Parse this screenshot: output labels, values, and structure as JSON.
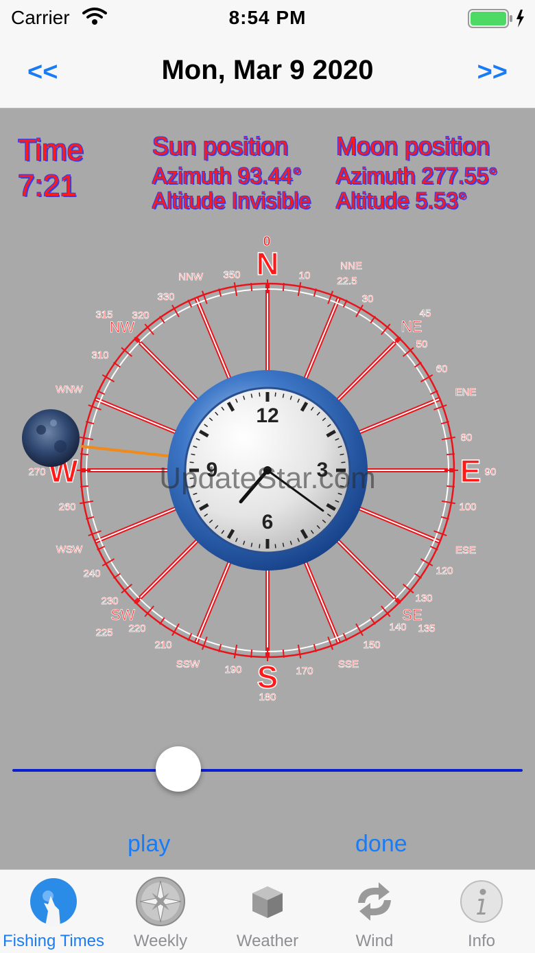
{
  "status_bar": {
    "carrier": "Carrier",
    "time": "8:54 PM"
  },
  "nav": {
    "prev_label": "<<",
    "title": "Mon, Mar 9 2020",
    "next_label": ">>"
  },
  "time_panel": {
    "label": "Time",
    "value": "7:21"
  },
  "sun": {
    "title": "Sun position",
    "azimuth": "Azimuth 93.44°",
    "altitude": "Altitude  Invisible"
  },
  "moon": {
    "title": "Moon position",
    "azimuth": "Azimuth 277.55°",
    "altitude": "Altitude  5.53°"
  },
  "compass": {
    "cardinals": [
      "N",
      "E",
      "S",
      "W"
    ],
    "degree_labels": [
      "0",
      "10",
      "30",
      "45",
      "50",
      "60",
      "80",
      "90",
      "100",
      "120",
      "130",
      "135",
      "140",
      "150",
      "170",
      "180",
      "190",
      "210",
      "220",
      "225",
      "230",
      "240",
      "260",
      "270",
      "280",
      "310",
      "315",
      "320",
      "330",
      "350",
      "22.5"
    ],
    "intercardinals": [
      "NE",
      "SE",
      "SW",
      "NW"
    ],
    "directions": [
      "NNE",
      "ENE",
      "ESE",
      "SSE",
      "SSW",
      "WSW",
      "WNW",
      "NNW"
    ],
    "moon_azimuth_deg": 277.55
  },
  "clock": {
    "numerals": [
      "12",
      "3",
      "6",
      "9"
    ],
    "hour": 7,
    "minute": 21
  },
  "watermark": "UpdateStar.com",
  "slider": {
    "value_fraction": 0.325
  },
  "controls": {
    "play_label": "play",
    "done_label": "done"
  },
  "tabs": [
    {
      "label": "Fishing Times",
      "icon": "wolf-moon-icon",
      "active": true
    },
    {
      "label": "Weekly",
      "icon": "compass-rose-icon",
      "active": false
    },
    {
      "label": "Weather",
      "icon": "cube-icon",
      "active": false
    },
    {
      "label": "Wind",
      "icon": "refresh-arrows-icon",
      "active": false
    },
    {
      "label": "Info",
      "icon": "info-icon",
      "active": false
    }
  ],
  "colors": {
    "accent": "#1a7cf5",
    "compass_red": "#ff1a1a",
    "background": "#a9a9a9",
    "slider": "#0a1fcf"
  }
}
